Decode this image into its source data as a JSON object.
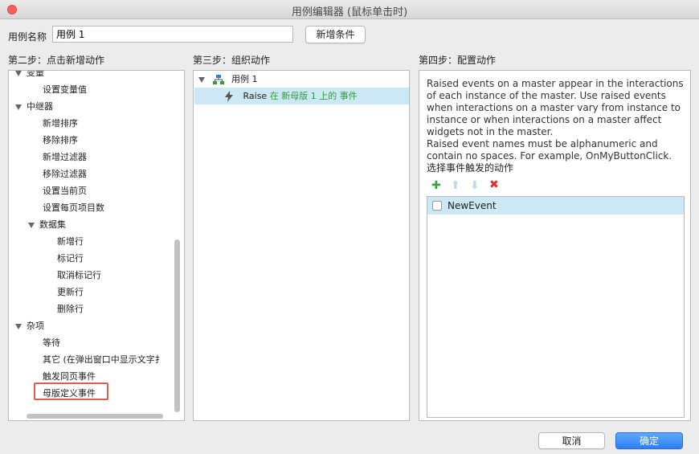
{
  "window": {
    "title": "用例编辑器 (鼠标单击时)"
  },
  "header": {
    "name_label": "用例名称",
    "name_value": "用例 1",
    "add_condition_label": "新增条件"
  },
  "left_panel": {
    "title": "第二步：点击新增动作",
    "items": [
      {
        "label": "变量",
        "level": 0,
        "expandable": true
      },
      {
        "label": "设置变量值",
        "level": 1
      },
      {
        "label": "中继器",
        "level": 0,
        "expandable": true
      },
      {
        "label": "新增排序",
        "level": 1
      },
      {
        "label": "移除排序",
        "level": 1
      },
      {
        "label": "新增过滤器",
        "level": 1
      },
      {
        "label": "移除过滤器",
        "level": 1
      },
      {
        "label": "设置当前页",
        "level": 1
      },
      {
        "label": "设置每页项目数",
        "level": 1
      },
      {
        "label": "数据集",
        "level": 1,
        "expandable": true
      },
      {
        "label": "新增行",
        "level": 2
      },
      {
        "label": "标记行",
        "level": 2
      },
      {
        "label": "取消标记行",
        "level": 2
      },
      {
        "label": "更新行",
        "level": 2
      },
      {
        "label": "删除行",
        "level": 2
      },
      {
        "label": "杂项",
        "level": 0,
        "expandable": true
      },
      {
        "label": "等待",
        "level": 1
      },
      {
        "label": "其它 (在弹出窗口中显示文字扌",
        "level": 1
      },
      {
        "label": "触发同页事件",
        "level": 1
      },
      {
        "label": "母版定义事件",
        "level": 1,
        "highlighted": true
      }
    ]
  },
  "middle_panel": {
    "title": "第三步：组织动作",
    "case_label": "用例 1",
    "action": {
      "prefix": "Raise",
      "detail": " 在 新母版 1 上的 事件"
    }
  },
  "right_panel": {
    "title": "第四步：配置动作",
    "description": "Raised events on a master appear in the interactions of each instance of the master. Use raised events when interactions on a master vary from instance to instance or when interactions on a master affect widgets not in the master.\nRaised event names must be alphanumeric and contain no spaces. For example, OnMyButtonClick.",
    "select_label": "选择事件触发的动作",
    "events": [
      {
        "name": "NewEvent",
        "checked": false
      }
    ]
  },
  "footer": {
    "cancel_label": "取消",
    "ok_label": "确定"
  },
  "colors": {
    "accent": "#2b7ff7",
    "selection": "#cbe8f4",
    "highlight": "#e15c4c",
    "action_text": "#2e9e3a"
  }
}
